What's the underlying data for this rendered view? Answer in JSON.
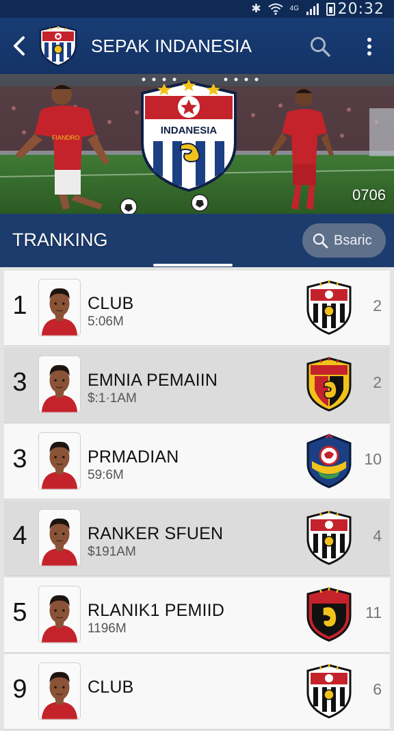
{
  "status_bar": {
    "time": "20:32",
    "network": "4G",
    "icons": [
      "bluetooth-icon",
      "wifi-icon",
      "signal-icon",
      "battery-icon"
    ]
  },
  "app_bar": {
    "title": "SEPAK INDANESIA",
    "icons": [
      "back-arrow-icon",
      "search-icon",
      "more-vertical-icon"
    ]
  },
  "hero": {
    "crest_text": "INDANESIA",
    "jersey_text": "FIANDRO",
    "count": "0706"
  },
  "ranking": {
    "title": "TRANKING",
    "search_placeholder": "Bsaric"
  },
  "rows": [
    {
      "rank": "1",
      "name": "CLUB",
      "value": "5:06M",
      "count": "2",
      "badge": "bw-stripes"
    },
    {
      "rank": "3",
      "name": "EMNIA PEMAIIN",
      "value": "$:1·1AM",
      "count": "2",
      "badge": "red-gold"
    },
    {
      "rank": "3",
      "name": "PRMADIAN",
      "value": "59:6M",
      "count": "10",
      "badge": "navy-ball"
    },
    {
      "rank": "4",
      "name": "RANKER SFUEN",
      "value": "$191AM",
      "count": "4",
      "badge": "bw-stripes"
    },
    {
      "rank": "5",
      "name": "RLANIK1 PEMIID",
      "value": "1196M",
      "count": "11",
      "badge": "red-black"
    },
    {
      "rank": "9",
      "name": "CLUB",
      "value": "",
      "count": "6",
      "badge": "bw-stripes"
    }
  ],
  "colors": {
    "app_bar": "#163a6e",
    "status_bar": "#0e2a55",
    "row_light": "#f8f8f8",
    "row_dark": "#dcdcdc",
    "brand_red": "#c4232b"
  }
}
